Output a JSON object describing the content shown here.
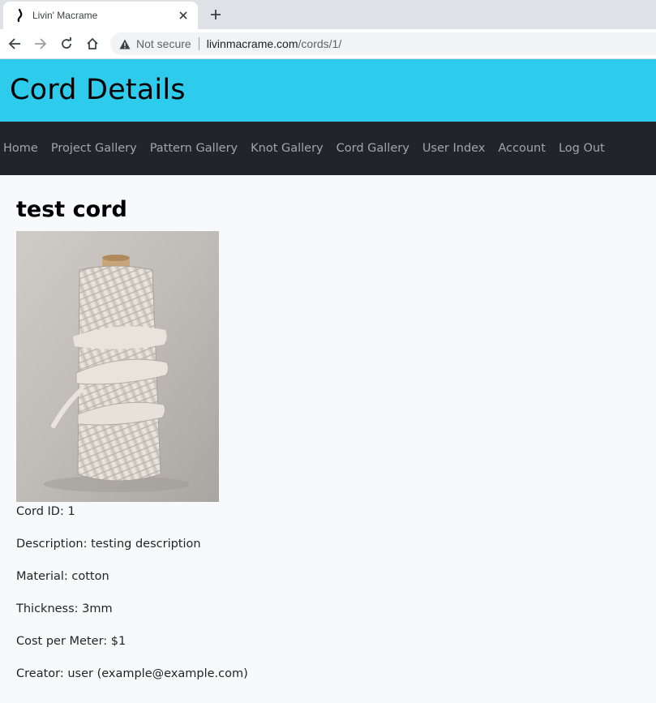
{
  "browser": {
    "tab_title": "Livin' Macrame",
    "omnibox": {
      "security_label": "Not secure",
      "domain": "livinmacrame.com",
      "path": "/cords/1/"
    }
  },
  "header": {
    "title": "Cord Details"
  },
  "nav": {
    "items": [
      {
        "label": "Home"
      },
      {
        "label": "Project Gallery"
      },
      {
        "label": "Pattern Gallery"
      },
      {
        "label": "Knot Gallery"
      },
      {
        "label": "Cord Gallery"
      },
      {
        "label": "User Index"
      },
      {
        "label": "Account"
      },
      {
        "label": "Log Out"
      }
    ]
  },
  "cord": {
    "name": "test cord",
    "details": [
      {
        "text": "Cord ID: 1"
      },
      {
        "text": "Description: testing description"
      },
      {
        "text": "Material: cotton"
      },
      {
        "text": "Thickness: 3mm"
      },
      {
        "text": "Cost per Meter: $1"
      },
      {
        "text": "Creator: user (example@example.com)"
      }
    ]
  },
  "colors": {
    "header_bg": "#2dcced",
    "navbar_bg": "#212529",
    "page_bg": "#f8f9fa"
  }
}
